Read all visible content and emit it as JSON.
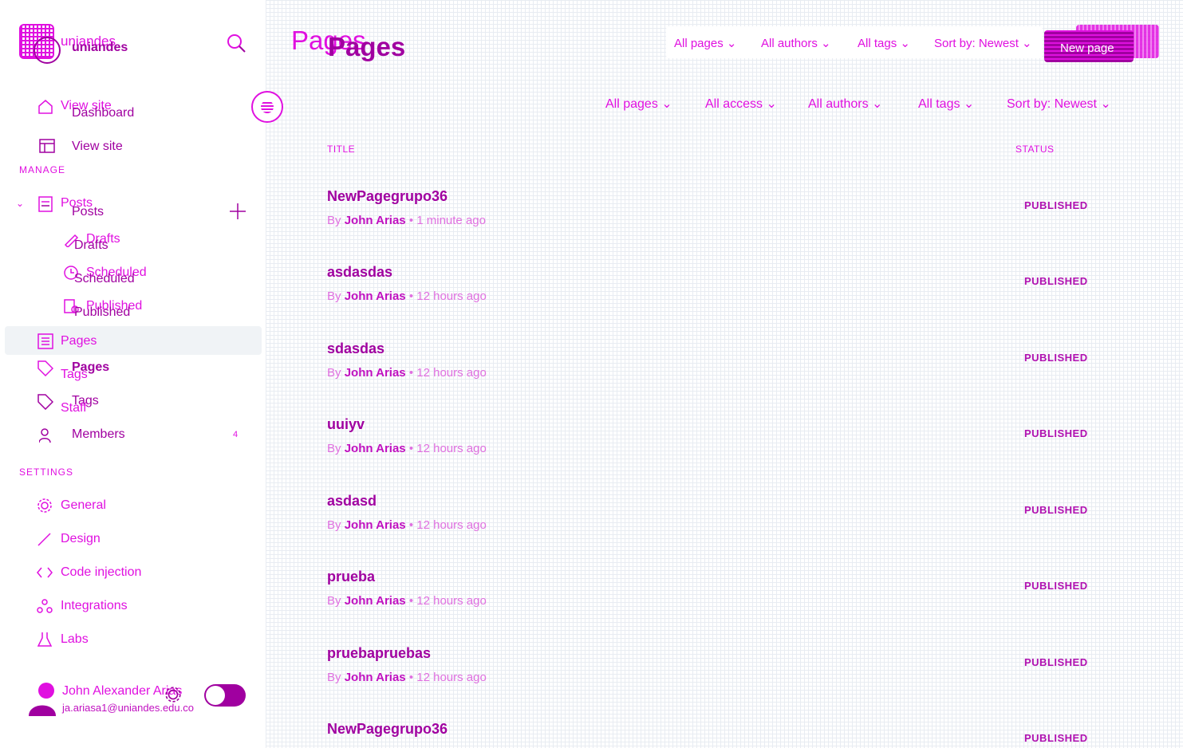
{
  "sidebar": {
    "brand": "uniandes",
    "brand_bold": "uniandes",
    "nav_top": [
      {
        "label": "View site",
        "icon": "home-icon"
      },
      {
        "label": "Dashboard",
        "icon": "dashboard-icon"
      },
      {
        "label": "View site",
        "icon": "view-site-icon"
      }
    ],
    "manage_title": "MANAGE",
    "posts": "Posts",
    "posts_ghost": "Posts",
    "drafts": "Drafts",
    "drafts_ghost": "Drafts",
    "scheduled": "Scheduled",
    "scheduled_ghost": "Scheduled",
    "published": "Published",
    "published_ghost": "Published",
    "pages": "Pages",
    "pages_ghost": "Pages",
    "tags": "Tags",
    "tags_ghost": "Tags",
    "staff": "Staff",
    "members": "Members",
    "members_count": "4",
    "settings_title": "SETTINGS",
    "settings_items": [
      "General",
      "Design",
      "Code injection",
      "Integrations",
      "Labs"
    ],
    "user_name": "John Alexander Arias",
    "user_email": "ja.ariasa1@uniandes.edu.co"
  },
  "main": {
    "title": "Pages",
    "title_ghost": "Pages",
    "toolbar_top": [
      "All pages",
      "All authors",
      "All tags",
      "Sort by: Newest"
    ],
    "new_page_label": "New page",
    "filters": [
      "All pages",
      "All access",
      "All authors",
      "All tags",
      "Sort by: Newest"
    ],
    "col_title": "TITLE",
    "col_status": "STATUS",
    "rows": [
      {
        "title": "NewPagegrupo36",
        "by": "By",
        "author": "John Arias",
        "time": "• 1 minute ago",
        "status": "PUBLISHED"
      },
      {
        "title": "asdasdas",
        "by": "By",
        "author": "John Arias",
        "time": "• 12 hours ago",
        "status": "PUBLISHED"
      },
      {
        "title": "sdasdas",
        "by": "By",
        "author": "John Arias",
        "time": "• 12 hours ago",
        "status": "PUBLISHED"
      },
      {
        "title": "uuiyv",
        "by": "By",
        "author": "John Arias",
        "time": "• 12 hours ago",
        "status": "PUBLISHED"
      },
      {
        "title": "asdasd",
        "by": "By",
        "author": "John Arias",
        "time": "• 12 hours ago",
        "status": "PUBLISHED"
      },
      {
        "title": "prueba",
        "by": "By",
        "author": "John Arias",
        "time": "• 12 hours ago",
        "status": "PUBLISHED"
      },
      {
        "title": "pruebapruebas",
        "by": "By",
        "author": "John Arias",
        "time": "• 12 hours ago",
        "status": "PUBLISHED"
      },
      {
        "title": "NewPagegrupo36",
        "by": "",
        "author": "",
        "time": "",
        "status": "PUBLISHED"
      }
    ]
  },
  "colors": {
    "accent": "#e010e0",
    "accent_dark": "#a000a0"
  }
}
